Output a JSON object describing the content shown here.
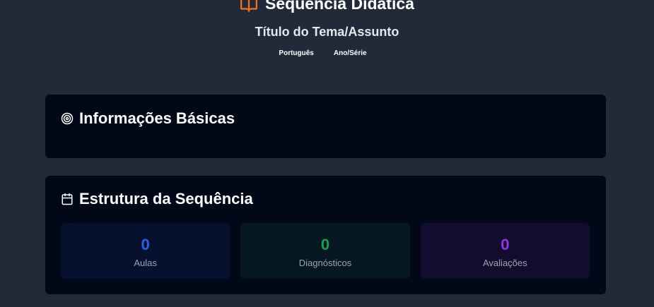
{
  "header": {
    "title": "Sequência Didática",
    "subtitle": "Título do Tema/Assunto",
    "subject": "Português",
    "grade": "Ano/Série"
  },
  "icons": {
    "title": "book-open-icon",
    "info": "target-icon",
    "structure": "calendar-icon"
  },
  "colors": {
    "background": "#212a39",
    "card": "#010817",
    "accent_orange": "#f97316",
    "blue": "#2563eb",
    "green": "#16a34a",
    "purple": "#9333ea"
  },
  "info_card": {
    "heading": "Informações Básicas"
  },
  "structure_card": {
    "heading": "Estrutura da Sequência",
    "stats": [
      {
        "value": "0",
        "label": "Aulas"
      },
      {
        "value": "0",
        "label": "Diagnósticos"
      },
      {
        "value": "0",
        "label": "Avaliações"
      }
    ]
  }
}
